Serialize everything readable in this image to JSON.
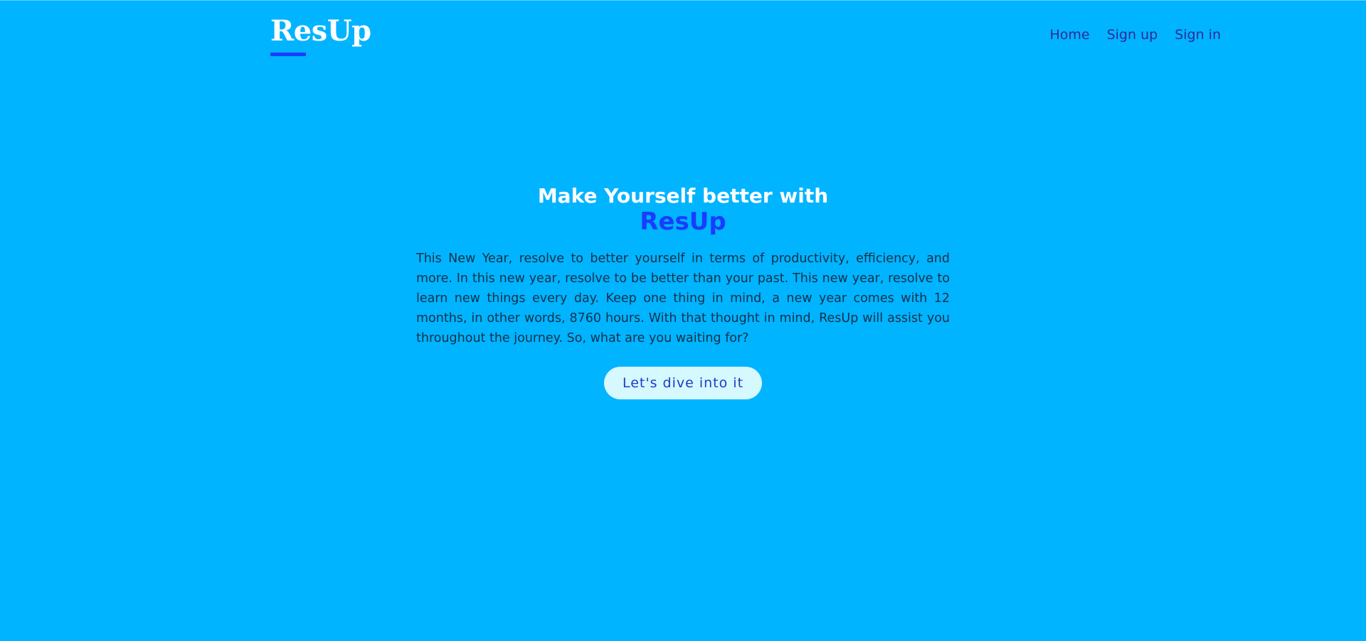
{
  "brand": {
    "logo_text": "ResUp"
  },
  "nav": {
    "items": [
      {
        "label": "Home"
      },
      {
        "label": "Sign up"
      },
      {
        "label": "Sign in"
      }
    ]
  },
  "hero": {
    "heading": "Make Yourself better with",
    "brand_highlight": "ResUp",
    "paragraph": "This New Year, resolve to better yourself in terms of productivity, efficiency, and more. In this new year, resolve to be better than your past. This new year, resolve to learn new things every day. Keep one thing in mind, a new year comes with 12 months, in other words, 8760 hours. With that thought in mind, ResUp will assist you throughout the journey. So, what are you waiting for?",
    "cta_label": "Let's dive into it"
  },
  "colors": {
    "background": "#00b4ff",
    "accent": "#1a3cff",
    "nav_text": "#2a2a9c",
    "button_bg": "#d6f8ff"
  }
}
